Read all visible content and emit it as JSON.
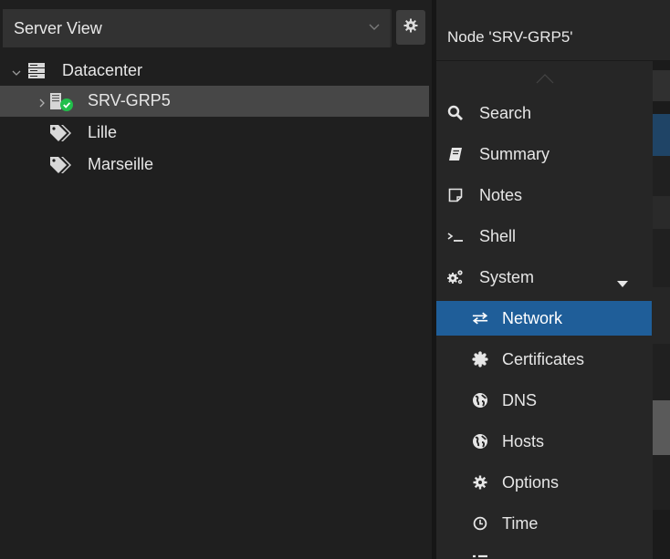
{
  "sidebar": {
    "view_selector": {
      "value": "Server View",
      "icon": "chevron-down-icon"
    },
    "settings_icon": "gear-icon",
    "tree": {
      "datacenter": {
        "label": "Datacenter",
        "icon": "server-rack-icon",
        "expanded": true
      },
      "node": {
        "label": "SRV-GRP5",
        "icon": "server-online-icon",
        "status": "online",
        "selected": true
      },
      "tags": [
        {
          "label": "Lille",
          "icon": "tag-icon"
        },
        {
          "label": "Marseille",
          "icon": "tag-icon"
        }
      ]
    }
  },
  "node_panel": {
    "title": "Node 'SRV-GRP5'",
    "menu": [
      {
        "label": "Search",
        "icon": "search-icon"
      },
      {
        "label": "Summary",
        "icon": "book-icon"
      },
      {
        "label": "Notes",
        "icon": "note-icon"
      },
      {
        "label": "Shell",
        "icon": "terminal-icon"
      },
      {
        "label": "System",
        "icon": "cogs-icon",
        "expandable": true
      },
      {
        "label": "Network",
        "icon": "exchange-icon",
        "active": true
      },
      {
        "label": "Certificates",
        "icon": "certificate-icon"
      },
      {
        "label": "DNS",
        "icon": "globe-icon"
      },
      {
        "label": "Hosts",
        "icon": "globe-icon"
      },
      {
        "label": "Options",
        "icon": "gear-icon"
      },
      {
        "label": "Time",
        "icon": "clock-icon"
      }
    ]
  },
  "colors": {
    "background": "#1e1e1e",
    "selected_row": "#474747",
    "active_menu": "#1f5e99",
    "status_ok": "#21bf4b",
    "text": "#e6e6e6"
  }
}
